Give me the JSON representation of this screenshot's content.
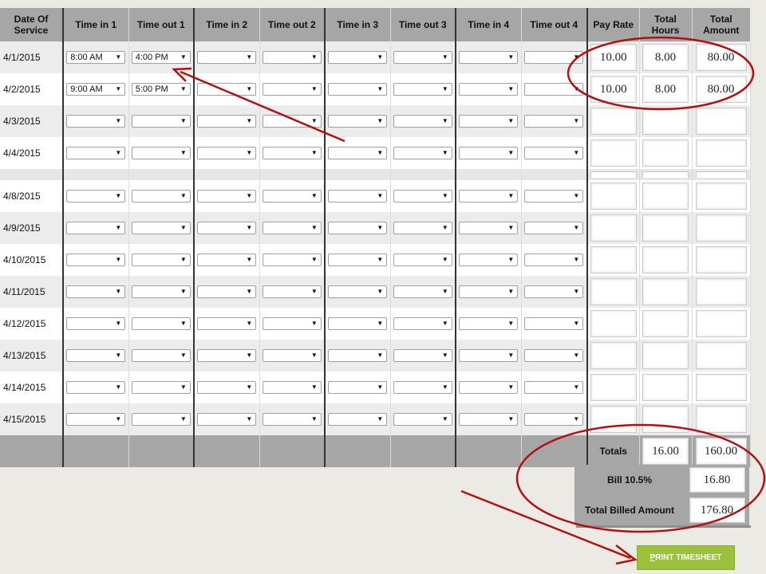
{
  "headers": [
    "Date Of Service",
    "Time in 1",
    "Time out 1",
    "Time in 2",
    "Time out 2",
    "Time in 3",
    "Time out 3",
    "Time in 4",
    "Time out 4",
    "Pay Rate",
    "Total Hours",
    "Total Amount"
  ],
  "rows": [
    {
      "date": "4/1/2015",
      "times": [
        "8:00 AM",
        "4:00 PM",
        "",
        "",
        "",
        "",
        "",
        ""
      ],
      "pay_rate": "10.00",
      "total_hours": "8.00",
      "total_amount": "80.00"
    },
    {
      "date": "4/2/2015",
      "times": [
        "9:00 AM",
        "5:00 PM",
        "",
        "",
        "",
        "",
        "",
        ""
      ],
      "pay_rate": "10.00",
      "total_hours": "8.00",
      "total_amount": "80.00"
    },
    {
      "date": "4/3/2015",
      "times": [
        "",
        "",
        "",
        "",
        "",
        "",
        "",
        ""
      ],
      "pay_rate": "",
      "total_hours": "",
      "total_amount": ""
    },
    {
      "date": "4/4/2015",
      "times": [
        "",
        "",
        "",
        "",
        "",
        "",
        "",
        ""
      ],
      "pay_rate": "",
      "total_hours": "",
      "total_amount": ""
    },
    {
      "date": "4/8/2015",
      "times": [
        "",
        "",
        "",
        "",
        "",
        "",
        "",
        ""
      ],
      "pay_rate": "",
      "total_hours": "",
      "total_amount": ""
    },
    {
      "date": "4/9/2015",
      "times": [
        "",
        "",
        "",
        "",
        "",
        "",
        "",
        ""
      ],
      "pay_rate": "",
      "total_hours": "",
      "total_amount": ""
    },
    {
      "date": "4/10/2015",
      "times": [
        "",
        "",
        "",
        "",
        "",
        "",
        "",
        ""
      ],
      "pay_rate": "",
      "total_hours": "",
      "total_amount": ""
    },
    {
      "date": "4/11/2015",
      "times": [
        "",
        "",
        "",
        "",
        "",
        "",
        "",
        ""
      ],
      "pay_rate": "",
      "total_hours": "",
      "total_amount": ""
    },
    {
      "date": "4/12/2015",
      "times": [
        "",
        "",
        "",
        "",
        "",
        "",
        "",
        ""
      ],
      "pay_rate": "",
      "total_hours": "",
      "total_amount": ""
    },
    {
      "date": "4/13/2015",
      "times": [
        "",
        "",
        "",
        "",
        "",
        "",
        "",
        ""
      ],
      "pay_rate": "",
      "total_hours": "",
      "total_amount": ""
    },
    {
      "date": "4/14/2015",
      "times": [
        "",
        "",
        "",
        "",
        "",
        "",
        "",
        ""
      ],
      "pay_rate": "",
      "total_hours": "",
      "total_amount": ""
    },
    {
      "date": "4/15/2015",
      "times": [
        "",
        "",
        "",
        "",
        "",
        "",
        "",
        ""
      ],
      "pay_rate": "",
      "total_hours": "",
      "total_amount": ""
    }
  ],
  "totals": {
    "label": "Totals",
    "hours": "16.00",
    "amount": "160.00"
  },
  "bill": {
    "fee_label": "Bill 10.5%",
    "fee_value": "16.80",
    "total_label": "Total Billed Amount",
    "total_value": "176.80"
  },
  "print_button": {
    "accesskey_letter": "P",
    "label_rest": "RINT TIMESHEET"
  },
  "colors": {
    "header_gray": "#a6a6a6",
    "button_green": "#9bc13c",
    "annotation_red": "#b01010",
    "page_bg": "#ebeae4"
  },
  "icons": {
    "dropdown": "dropdown-arrow-icon"
  }
}
